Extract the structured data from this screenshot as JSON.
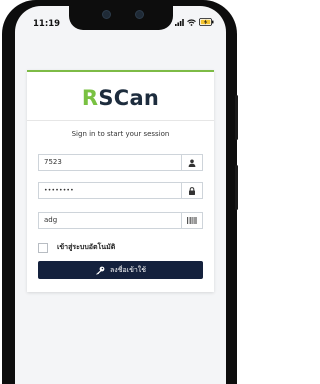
{
  "status_bar": {
    "time": "11:19",
    "icons": [
      "signal-icon",
      "wifi-icon",
      "battery-charging-icon"
    ]
  },
  "login": {
    "brand_prefix": "R",
    "brand_rest": "SCan",
    "subtitle": "Sign in to start your session",
    "username_value": "7523",
    "password_value": "••••••••",
    "code_value": "adg",
    "remember_label": "เข้าสู่ระบบอัตโนมัติ",
    "login_button_label": "ลงชื่อเข้าใช้"
  },
  "colors": {
    "brand_navy": "#1d2c3d",
    "brand_green": "#79c142",
    "button_bg": "#14213d"
  }
}
